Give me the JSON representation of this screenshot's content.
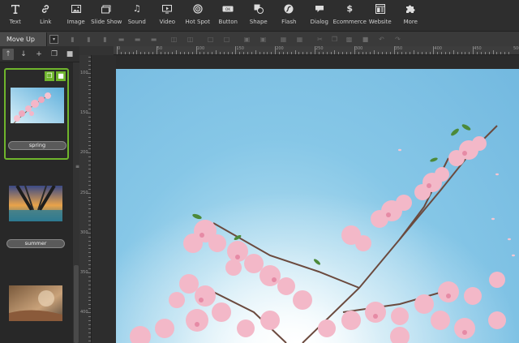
{
  "toolbar": {
    "items": [
      {
        "label": "Text",
        "icon": "text-icon"
      },
      {
        "label": "Link",
        "icon": "link-icon"
      },
      {
        "label": "Image",
        "icon": "image-icon"
      },
      {
        "label": "Slide Show",
        "icon": "slideshow-icon"
      },
      {
        "label": "Sound",
        "icon": "music-note-icon"
      },
      {
        "label": "Video",
        "icon": "video-icon"
      },
      {
        "label": "Hot Spot",
        "icon": "target-icon"
      },
      {
        "label": "Button",
        "icon": "button-icon"
      },
      {
        "label": "Shape",
        "icon": "shape-icon"
      },
      {
        "label": "Flash",
        "icon": "flash-icon"
      },
      {
        "label": "Dialog",
        "icon": "dialog-icon"
      },
      {
        "label": "Ecommerce",
        "icon": "dollar-icon"
      },
      {
        "label": "Website",
        "icon": "website-icon"
      },
      {
        "label": "More",
        "icon": "puzzle-icon"
      }
    ]
  },
  "editbar": {
    "tab_label": "Move Up"
  },
  "ruler": {
    "h_labels": [
      "0",
      "50",
      "100",
      "150",
      "200",
      "250",
      "300",
      "350",
      "400",
      "450",
      "500",
      "550",
      "600",
      "650"
    ],
    "v_labels": [
      "100",
      "150",
      "200",
      "250",
      "300",
      "350",
      "400",
      "450"
    ]
  },
  "slides": [
    {
      "label": "spring",
      "selected": true
    },
    {
      "label": "summer",
      "selected": false
    },
    {
      "label": "",
      "selected": false
    }
  ],
  "colors": {
    "accent": "#6fb52c",
    "sky": "#74b9e0",
    "blossom": "#f3b8c8"
  }
}
